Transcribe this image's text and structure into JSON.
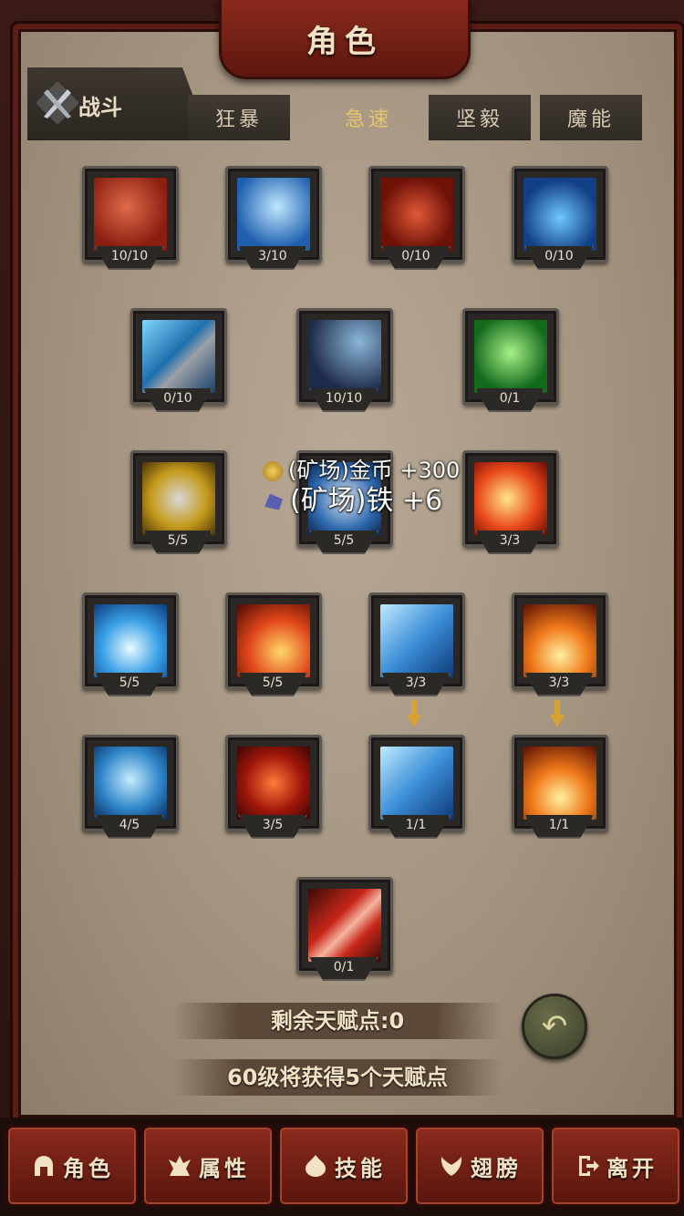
{
  "header": {
    "title": "角色"
  },
  "tabs": {
    "main": {
      "label": "战斗"
    },
    "sub": [
      {
        "label": "狂暴",
        "active": false
      },
      {
        "label": "急速",
        "active": true
      },
      {
        "label": "坚毅",
        "active": false
      },
      {
        "label": "魔能",
        "active": false
      }
    ]
  },
  "skills": [
    {
      "level": "10/10"
    },
    {
      "level": "3/10"
    },
    {
      "level": "0/10"
    },
    {
      "level": "0/10"
    },
    {
      "level": "0/10"
    },
    {
      "level": "10/10"
    },
    {
      "level": "0/1"
    },
    {
      "level": "5/5"
    },
    {
      "level": "5/5"
    },
    {
      "level": "3/3"
    },
    {
      "level": "5/5"
    },
    {
      "level": "5/5"
    },
    {
      "level": "3/3"
    },
    {
      "level": "3/3"
    },
    {
      "level": "4/5"
    },
    {
      "level": "3/5"
    },
    {
      "level": "1/1"
    },
    {
      "level": "1/1"
    },
    {
      "level": "0/1"
    }
  ],
  "rewards": {
    "gold": "(矿场)金币 +300",
    "iron": "(矿场)铁 +6"
  },
  "talent": {
    "remaining": "剩余天赋点:0",
    "next": "60级将获得5个天赋点"
  },
  "nav": [
    {
      "label": "角色",
      "icon": "helmet-icon"
    },
    {
      "label": "属性",
      "icon": "attribute-icon"
    },
    {
      "label": "技能",
      "icon": "skill-icon"
    },
    {
      "label": "翅膀",
      "icon": "wings-icon"
    },
    {
      "label": "离开",
      "icon": "exit-icon"
    }
  ],
  "colors": {
    "accent": "#e9c46a",
    "banner": "#8a2a1c",
    "panel": "#a39480"
  }
}
